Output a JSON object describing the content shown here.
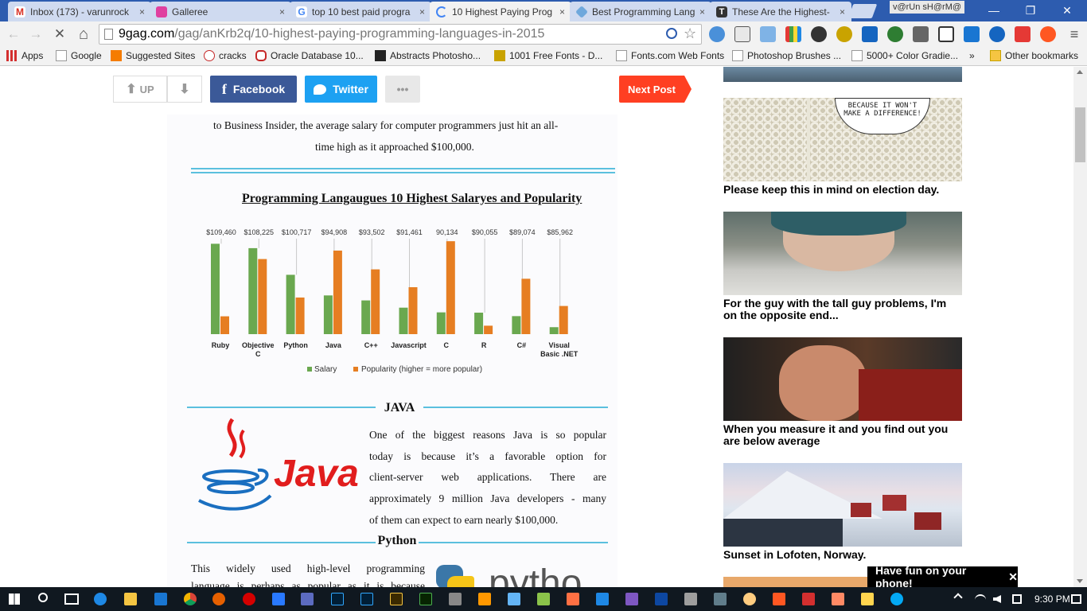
{
  "browser": {
    "tabs": [
      {
        "title": "Inbox (173) - varunrock",
        "icon_color": "#d93025"
      },
      {
        "title": "Galleree",
        "icon_color": "#e040a0"
      },
      {
        "title": "top 10 best paid progra",
        "icon_color": "#4285f4"
      },
      {
        "title": "10 Highest Paying Prog",
        "icon_color": "#4285f4"
      },
      {
        "title": "Best Programming Lang",
        "icon_color": "#6fa8dc"
      },
      {
        "title": "These Are the Highest-",
        "icon_color": "#333333"
      }
    ],
    "close_glyph": "×",
    "profile": "v@rUn sH@rM@",
    "window_controls": {
      "minimize": "—",
      "restore": "❐",
      "close": "✕"
    },
    "nav": {
      "back": "←",
      "forward": "→",
      "stop": "✕",
      "home": "⌂"
    },
    "url": {
      "host": "9gag.com",
      "path": "/gag/anKrb2q/10-highest-paying-programming-languages-in-2015"
    },
    "bookmarks": [
      {
        "label": "Apps"
      },
      {
        "label": "Google"
      },
      {
        "label": "Suggested Sites"
      },
      {
        "label": "cracks"
      },
      {
        "label": "Oracle Database 10..."
      },
      {
        "label": "Abstracts Photosho..."
      },
      {
        "label": "1001 Free Fonts - D..."
      },
      {
        "label": "Fonts.com Web Fonts"
      },
      {
        "label": "Photoshop Brushes ..."
      },
      {
        "label": "5000+ Color Gradie..."
      },
      {
        "label": "»"
      },
      {
        "label": "Other bookmarks"
      }
    ]
  },
  "post": {
    "up_label": "UP",
    "facebook_label": "Facebook",
    "twitter_label": "Twitter",
    "more_label": "•••",
    "next_label": "Next Post",
    "intro_line1": "to Business Insider, the average salary for computer programmers just hit an all-",
    "intro_line2": "time high as it approached $100,000.",
    "java_heading": "JAVA",
    "java_logo_text": "Java",
    "java_text": [
      "One of the biggest reasons Java is so popular",
      "today is because it’s a favorable option for",
      "client-server web applications. There are",
      "approximately 9 million Java developers - many",
      "of them can expect to earn nearly $100,000."
    ],
    "python_heading": "Python",
    "python_text": [
      "This widely used high-level programming",
      "language is perhaps as popular as it is because"
    ],
    "python_logo_text": "pytho"
  },
  "chart_data": {
    "type": "bar",
    "title": "Programming Langaugues 10 Highest Salaryes and Popularity",
    "categories": [
      "Ruby",
      "Objective C",
      "Python",
      "Java",
      "C++",
      "Javascript",
      "C",
      "R",
      "C#",
      "Visual Basic .NET"
    ],
    "category_lines": [
      [
        "Ruby"
      ],
      [
        "Objective",
        "C"
      ],
      [
        "Python"
      ],
      [
        "Java"
      ],
      [
        "C++"
      ],
      [
        "Javascript"
      ],
      [
        "C"
      ],
      [
        "R"
      ],
      [
        "C#"
      ],
      [
        "Visual",
        "Basic .NET"
      ]
    ],
    "data_labels": [
      "$109,460",
      "$108,225",
      "$100,717",
      "$94,908",
      "$93,502",
      "$91,461",
      "90,134",
      "$90,055",
      "$89,074",
      "$85,962"
    ],
    "series": [
      {
        "name": "Salary",
        "color": "#6aa84f",
        "values": [
          109460,
          108225,
          100717,
          94908,
          93502,
          91461,
          90134,
          90055,
          89074,
          85962
        ]
      },
      {
        "name": "Popularity (higher = more popular)",
        "color": "#e67e22",
        "relative_values": [
          0.19,
          0.8,
          0.39,
          0.89,
          0.69,
          0.5,
          0.99,
          0.09,
          0.59,
          0.3
        ]
      }
    ],
    "legend_position": "bottom",
    "grid": false
  },
  "sidebar": {
    "items": [
      {
        "caption": "Please keep this in mind on election day.",
        "speech": "BECAUSE IT WON'T MAKE A DIFFERENCE!"
      },
      {
        "caption": "For the guy with the tall guy problems, I'm on the opposite end..."
      },
      {
        "caption": "When you measure it and you find out you are below average"
      },
      {
        "caption": "Sunset in Lofoten, Norway."
      }
    ]
  },
  "toast": {
    "label": "Have fun on your phone!",
    "close": "✕"
  },
  "taskbar": {
    "time": "9:30 PM"
  }
}
